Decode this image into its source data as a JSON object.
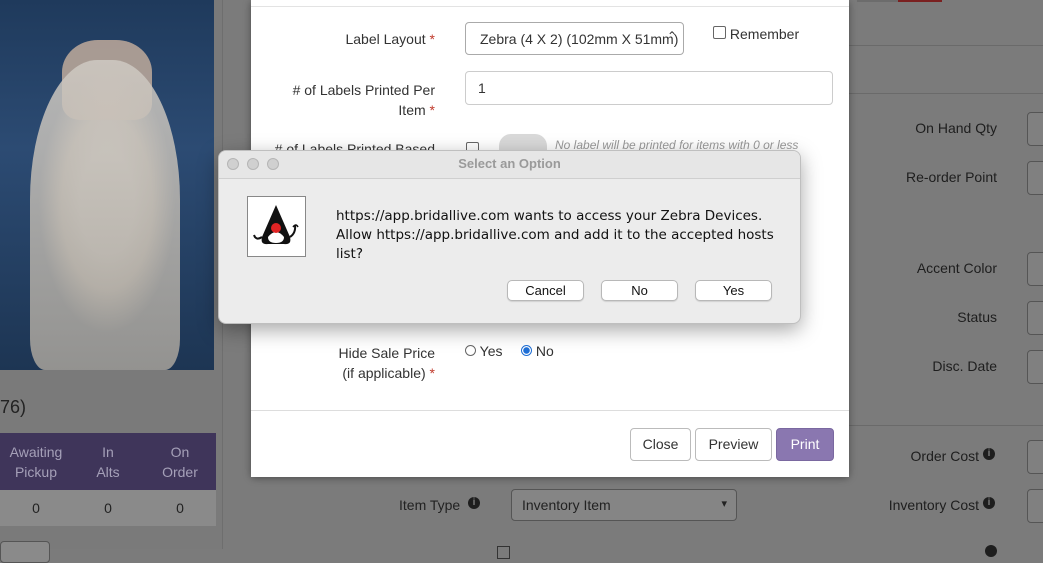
{
  "left_panel": {
    "count_text": "76)",
    "stats": [
      {
        "label_line1": "Awaiting",
        "label_line2": "Pickup",
        "value": "0"
      },
      {
        "label_line1": "In",
        "label_line2": "Alts",
        "value": "0"
      },
      {
        "label_line1": "On",
        "label_line2": "Order",
        "value": "0"
      }
    ]
  },
  "background_form": {
    "on_hand_qty": "On Hand Qty",
    "reorder_point": "Re-order Point",
    "accent_color": "Accent Color",
    "status": "Status",
    "disc_date": "Disc. Date",
    "order_cost": "Order Cost",
    "inventory_cost": "Inventory Cost",
    "item_type_label": "Item Type",
    "item_type_value": "Inventory Item"
  },
  "label_modal": {
    "label_layout": "Label Layout",
    "label_layout_value": "Zebra (4 X 2) (102mm X 51mm)",
    "remember": "Remember",
    "labels_per_item_line1": "# of Labels Printed Per",
    "labels_per_item_line2": "Item",
    "labels_per_item_value": "1",
    "labels_based_partial": "# of Labels Printed Based",
    "labels_based_hint": "No label will be printed for items with 0 or less",
    "hide_sale_price_line1": "Hide Sale Price",
    "hide_sale_price_line2": "(if applicable)",
    "yes": "Yes",
    "no": "No",
    "close": "Close",
    "preview": "Preview",
    "print": "Print"
  },
  "dialog": {
    "title": "Select an Option",
    "message_line1": "https://app.bridallive.com wants to access your Zebra Devices.",
    "message_line2": "Allow https://app.bridallive.com and add it to the accepted hosts list?",
    "cancel": "Cancel",
    "no": "No",
    "yes": "Yes"
  }
}
